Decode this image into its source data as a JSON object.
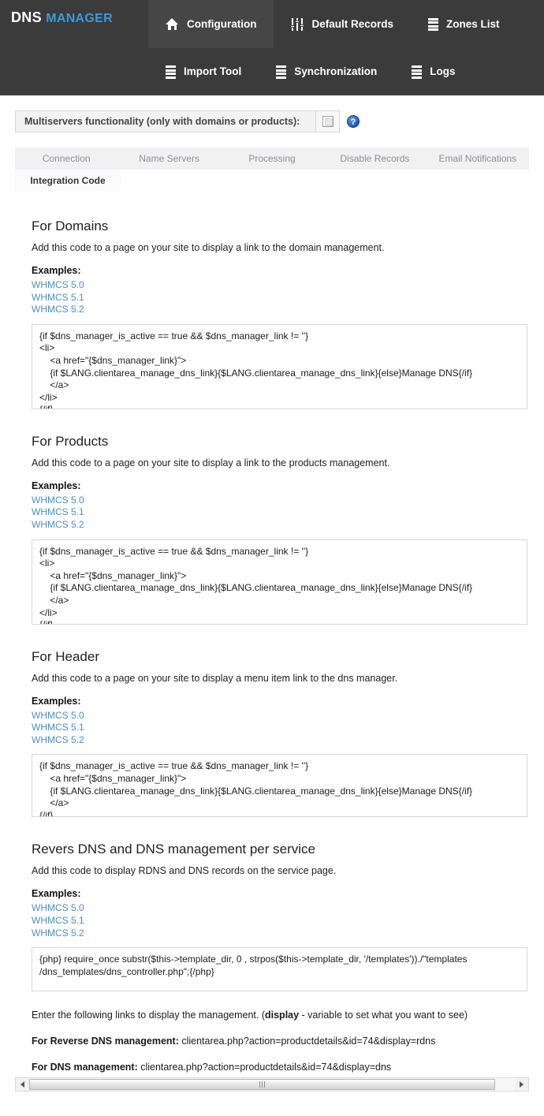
{
  "header": {
    "brand_primary": "DNS",
    "brand_secondary": "MANAGER",
    "nav_row1": [
      {
        "label": "Configuration",
        "icon": "home-icon",
        "active": true
      },
      {
        "label": "Default Records",
        "icon": "sliders-icon",
        "active": false
      },
      {
        "label": "Zones List",
        "icon": "server-icon",
        "active": false
      }
    ],
    "nav_row2": [
      {
        "label": "Import Tool",
        "icon": "server-icon",
        "active": false
      },
      {
        "label": "Synchronization",
        "icon": "server-icon",
        "active": false
      },
      {
        "label": "Logs",
        "icon": "server-icon",
        "active": false
      }
    ]
  },
  "multiservers": {
    "label": "Multiservers functionality (only with domains or products):",
    "checked": false,
    "help_glyph": "?"
  },
  "tabs": {
    "row1": [
      {
        "label": "Connection",
        "active": false
      },
      {
        "label": "Name Servers",
        "active": false
      },
      {
        "label": "Processing",
        "active": false
      },
      {
        "label": "Disable Records",
        "active": false
      },
      {
        "label": "Email Notifications",
        "active": false
      }
    ],
    "row2": [
      {
        "label": "Integration Code",
        "active": true
      }
    ]
  },
  "sections": [
    {
      "title": "For Domains",
      "description": "Add this code to a page on your site to display a link to the domain management.",
      "examples_label": "Examples:",
      "examples": [
        "WHMCS 5.0",
        "WHMCS 5.1",
        "WHMCS 5.2"
      ],
      "code": "{if $dns_manager_is_active == true && $dns_manager_link != ''}\n<li>\n    <a href=\"{$dns_manager_link}\">\n    {if $LANG.clientarea_manage_dns_link}{$LANG.clientarea_manage_dns_link}{else}Manage DNS{/if}\n    </a>\n</li>\n{/if}"
    },
    {
      "title": "For Products",
      "description": "Add this code to a page on your site to display a link to the products management.",
      "examples_label": "Examples:",
      "examples": [
        "WHMCS 5.0",
        "WHMCS 5.1",
        "WHMCS 5.2"
      ],
      "code": "{if $dns_manager_is_active == true && $dns_manager_link != ''}\n<li>\n    <a href=\"{$dns_manager_link}\">\n    {if $LANG.clientarea_manage_dns_link}{$LANG.clientarea_manage_dns_link}{else}Manage DNS{/if}\n    </a>\n</li>\n{/if}"
    },
    {
      "title": "For Header",
      "description": "Add this code to a page on your site to display a menu item link to the dns manager.",
      "examples_label": "Examples:",
      "examples": [
        "WHMCS 5.0",
        "WHMCS 5.1",
        "WHMCS 5.2"
      ],
      "code": "{if $dns_manager_is_active == true && $dns_manager_link != ''}\n    <a href=\"{$dns_manager_link}\">\n    {if $LANG.clientarea_manage_dns_link}{$LANG.clientarea_manage_dns_link}{else}Manage DNS{/if}\n    </a>\n{/if}"
    },
    {
      "title": "Revers DNS and DNS management per service",
      "description": "Add this code to display RDNS and DNS records on the service page.",
      "examples_label": "Examples:",
      "examples": [
        "WHMCS 5.0",
        "WHMCS 5.1",
        "WHMCS 5.2"
      ],
      "code": "{php} require_once substr($this->template_dir, 0 , strpos($this->template_dir, '/templates'))./\"templates\n/dns_templates/dns_controller.php\";{/php}"
    }
  ],
  "footer": {
    "note_prefix": "Enter the following links to display the management. (",
    "note_bold": "display",
    "note_suffix": " - variable to set what you want to see)",
    "rdns_label": "For Reverse DNS management:",
    "rdns_value": " clientarea.php?action=productdetails&id=74&display=rdns",
    "dns_label": "For DNS management:",
    "dns_value": " clientarea.php?action=productdetails&id=74&display=dns"
  }
}
